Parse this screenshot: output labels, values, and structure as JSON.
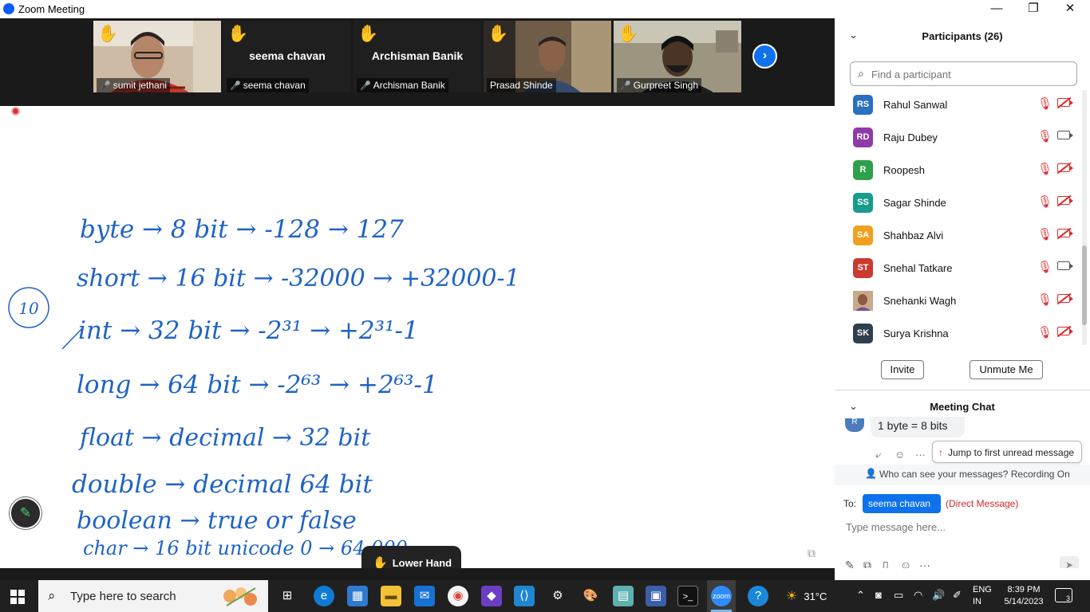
{
  "window": {
    "title": "Zoom Meeting",
    "minimize": "—",
    "maximize": "❐",
    "close": "✕"
  },
  "video_tiles": [
    {
      "name": "sumit jethani",
      "big_name": "",
      "hand": "✋",
      "video": true,
      "bg": "#c9b8a4"
    },
    {
      "name": "seema chavan",
      "big_name": "seema chavan",
      "hand": "✋",
      "video": false,
      "bg": "#1f1f1f"
    },
    {
      "name": "Archisman Banik",
      "big_name": "Archisman Banik",
      "hand": "✋",
      "video": false,
      "bg": "#1f1f1f"
    },
    {
      "name": "Prasad Shinde",
      "big_name": "",
      "hand": "✋",
      "video": true,
      "bg": "#6a5a48"
    },
    {
      "name": "Gurpreet Singh",
      "big_name": "",
      "hand": "✋",
      "video": true,
      "bg": "#8d8570"
    }
  ],
  "next_page_icon": "›",
  "whiteboard": {
    "lines": [
      "byte → 8 bit → -128 → 127",
      "short → 16 bit → -32000 → +32000-1",
      "int → 32 bit → -2³¹ → +2³¹-1",
      "long → 64 bit → -2⁶³ → +2⁶³-1",
      "float → decimal → 32 bit",
      "double → decimal 64 bit",
      "boolean → true or false",
      "char → 16 bit unicode   0 → 64,000"
    ],
    "circled_number": "10",
    "ink_color": "#1f63c6"
  },
  "lower_hand": {
    "icon": "✋",
    "label": "Lower Hand"
  },
  "participants": {
    "title": "Participants (26)",
    "search_placeholder": "Find a participant",
    "list": [
      {
        "initials": "RS",
        "name": "Rahul Sanwal",
        "color": "#2a6fc0",
        "video_on": false
      },
      {
        "initials": "RD",
        "name": "Raju Dubey",
        "color": "#8e3aa8",
        "video_on": true
      },
      {
        "initials": "R",
        "name": "Roopesh",
        "color": "#2ea14d",
        "video_on": false
      },
      {
        "initials": "SS",
        "name": "Sagar Shinde",
        "color": "#179c8d",
        "video_on": false
      },
      {
        "initials": "SA",
        "name": "Shahbaz Alvi",
        "color": "#f0a01e",
        "video_on": false
      },
      {
        "initials": "ST",
        "name": "Snehal Tatkare",
        "color": "#c93a2f",
        "video_on": true
      },
      {
        "initials": "",
        "name": "Snehanki Wagh",
        "color": "#a7785a",
        "video_on": false
      },
      {
        "initials": "SK",
        "name": "Surya Krishna",
        "color": "#2f3e4e",
        "video_on": false
      }
    ],
    "invite_label": "Invite",
    "unmute_label": "Unmute Me"
  },
  "chat": {
    "title": "Meeting Chat",
    "avatar_initial": "R",
    "last_message": "1 byte = 8 bits",
    "jump_label": "Jump to first unread message",
    "who_can_see": "Who can see your messages? Recording On",
    "to_label": "To:",
    "recipient": "seema chavan",
    "direct_message": "(Direct Message)",
    "input_placeholder": "Type message here..."
  },
  "taskbar": {
    "search_text": "Type here to search",
    "weather": "31°C",
    "lang_top": "ENG",
    "lang_bottom": "IN",
    "time": "8:39 PM",
    "date": "5/14/2023",
    "notif_count": "3"
  }
}
